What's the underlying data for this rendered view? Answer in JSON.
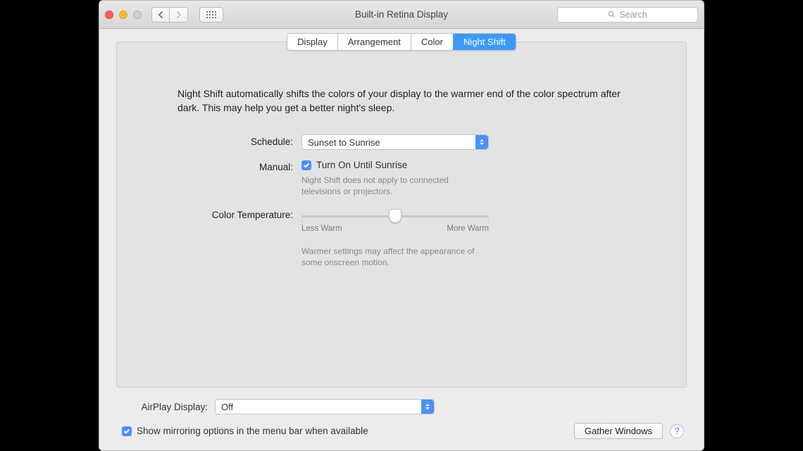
{
  "window": {
    "title": "Built-in Retina Display"
  },
  "search": {
    "placeholder": "Search"
  },
  "tabs": {
    "display": "Display",
    "arrangement": "Arrangement",
    "color": "Color",
    "night_shift": "Night Shift",
    "selected": "night_shift"
  },
  "intro": "Night Shift automatically shifts the colors of your display to the warmer end of the color spectrum after dark. This may help you get a better night's sleep.",
  "schedule": {
    "label": "Schedule:",
    "value": "Sunset to Sunrise"
  },
  "manual": {
    "label": "Manual:",
    "checkbox_label": "Turn On Until Sunrise",
    "checked": true,
    "hint": "Night Shift does not apply to connected televisions or projectors."
  },
  "color_temp": {
    "label": "Color Temperature:",
    "min_label": "Less Warm",
    "max_label": "More Warm",
    "value_percent": 50,
    "hint": "Warmer settings may affect the appearance of some onscreen motion."
  },
  "airplay": {
    "label": "AirPlay Display:",
    "value": "Off"
  },
  "mirroring": {
    "label": "Show mirroring options in the menu bar when available",
    "checked": true
  },
  "gather_label": "Gather Windows",
  "help_label": "?"
}
